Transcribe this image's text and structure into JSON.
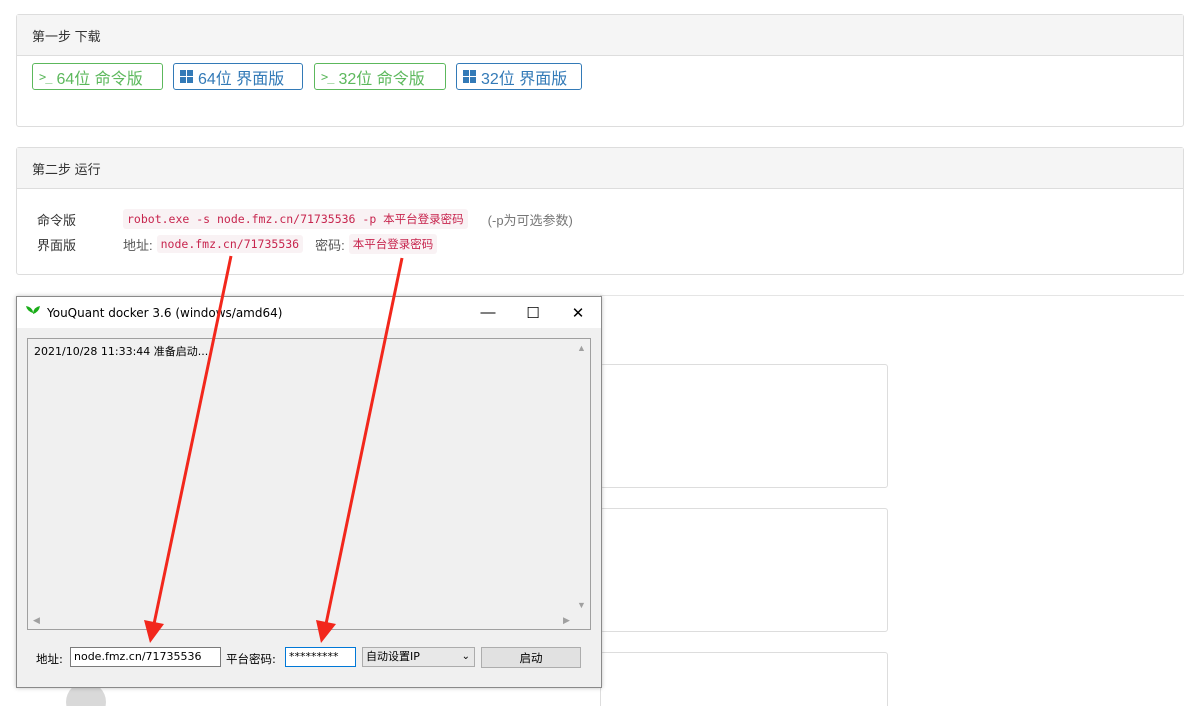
{
  "step1": {
    "heading": "第一步 下载",
    "buttons": [
      {
        "icon": "terminal-icon",
        "label": "64位 命令版",
        "color": "#5cb85c"
      },
      {
        "icon": "windows-icon",
        "label": "64位 界面版",
        "color": "#337ab7"
      },
      {
        "icon": "terminal-icon",
        "label": "32位 命令版",
        "color": "#5cb85c"
      },
      {
        "icon": "windows-icon",
        "label": "32位 界面版",
        "color": "#337ab7"
      }
    ],
    "terminal_glyph": ">_"
  },
  "step2": {
    "heading": "第二步 运行",
    "cmd_label": "命令版",
    "cmd_code": "robot.exe -s node.fmz.cn/71735536 -p 本平台登录密码",
    "cmd_note": "(-p为可选参数)",
    "gui_label": "界面版",
    "addr_label": "地址:",
    "addr_value": "node.fmz.cn/71735536",
    "pwd_label": "密码:",
    "pwd_value": "本平台登录密码"
  },
  "dialog": {
    "title": "YouQuant docker 3.6 (windows/amd64)",
    "minimize": "—",
    "maximize": "☐",
    "close": "✕",
    "log_line": "2021/10/28 11:33:44 准备启动...",
    "addr_label": "地址:",
    "addr_value": "node.fmz.cn/71735536",
    "pwd_label": "平台密码:",
    "pwd_value": "*********",
    "ip_option": "自动设置IP",
    "start_label": "启动"
  },
  "colors": {
    "arrow": "#f2271c",
    "code_text": "#c7254e",
    "code_bg": "#f9f2f4"
  }
}
